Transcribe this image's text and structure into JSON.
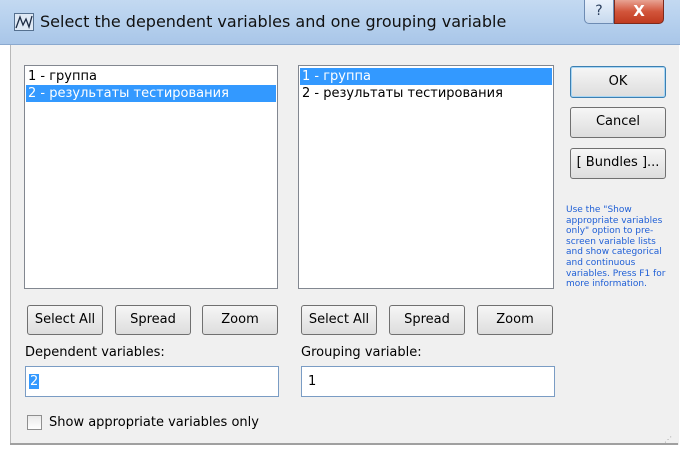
{
  "window": {
    "title": "Select the dependent variables and one grouping variable",
    "help_glyph": "?",
    "close_glyph": "X",
    "icon": "statistica-app-icon"
  },
  "left_panel": {
    "items": [
      {
        "label": "1 - группа",
        "selected": false
      },
      {
        "label": "2 - результаты тестирования",
        "selected": true
      }
    ],
    "select_all_label": "Select All",
    "spread_label": "Spread",
    "zoom_label": "Zoom",
    "field_label": "Dependent variables:",
    "field_value": "2"
  },
  "right_panel": {
    "items": [
      {
        "label": "1 - группа",
        "selected": true
      },
      {
        "label": "2 - результаты тестирования",
        "selected": false
      }
    ],
    "select_all_label": "Select All",
    "spread_label": "Spread",
    "zoom_label": "Zoom",
    "field_label": "Grouping variable:",
    "field_value": "1"
  },
  "actions": {
    "ok_label": "OK",
    "cancel_label": "Cancel",
    "bundles_label": "[ Bundles ]..."
  },
  "hint_text": "Use the \"Show appropriate variables only\" option to pre-screen variable lists and show categorical and continuous variables. Press F1 for more information.",
  "show_appropriate": {
    "label": "Show appropriate variables only",
    "checked": false
  },
  "colors": {
    "selection": "#3399ff",
    "hint_text": "#1f5fd6",
    "title_bar": "#b7d1ee",
    "close_button": "#c9472c"
  }
}
